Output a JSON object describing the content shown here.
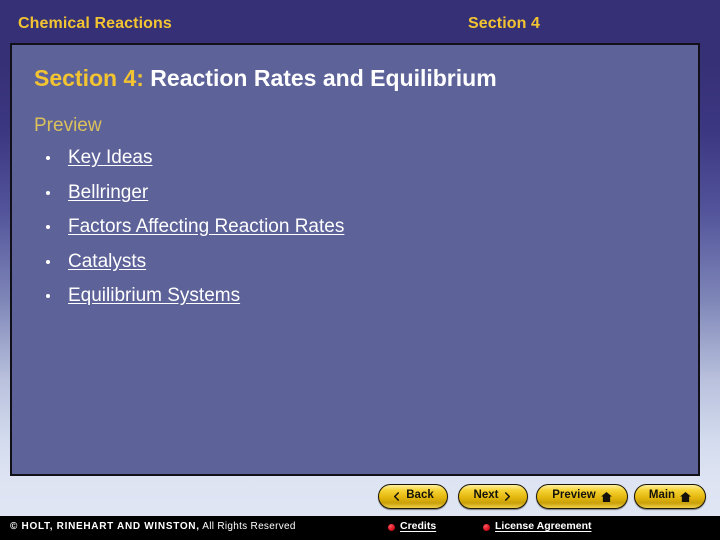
{
  "header": {
    "left_title": "Chemical Reactions",
    "right_title": "Section 4"
  },
  "slide": {
    "title_prefix": "Section 4:",
    "title_text": " Reaction Rates and Equilibrium",
    "preview_label": "Preview",
    "links": [
      {
        "label": "Key Ideas"
      },
      {
        "label": "Bellringer"
      },
      {
        "label": "Factors Affecting Reaction Rates"
      },
      {
        "label": "Catalysts"
      },
      {
        "label": "Equilibrium Systems"
      }
    ]
  },
  "nav": {
    "back": "Back",
    "next": "Next",
    "preview": "Preview",
    "main": "Main"
  },
  "footer": {
    "copyright_caps": "© HOLT, RINEHART AND WINSTON,",
    "copyright_rest": " All Rights Reserved",
    "credits": "Credits",
    "license": "License Agreement"
  },
  "colors": {
    "gold": "#f3c431",
    "panel": "#5d6299",
    "header_bg": "#363076",
    "link_red": "#d8121f",
    "white": "#ffffff"
  }
}
